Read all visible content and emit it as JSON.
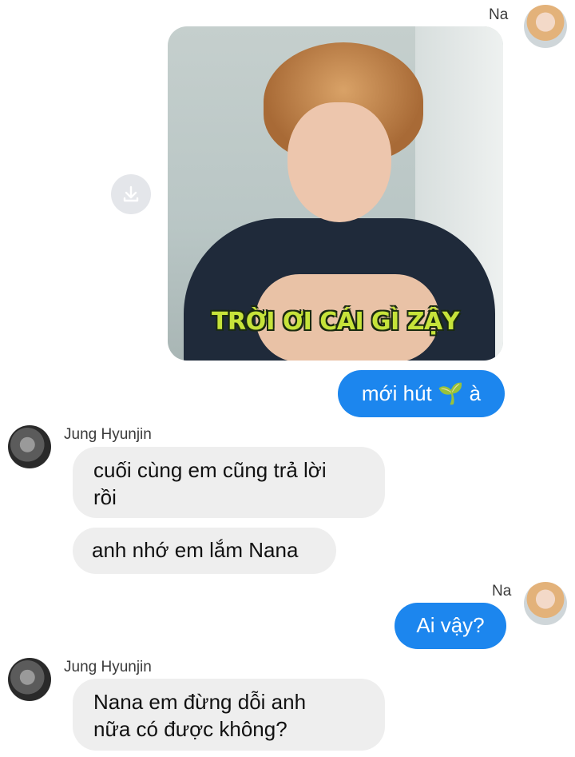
{
  "messages": {
    "m1": {
      "sender": "Na",
      "image_caption": "TRỜI ƠI CÁI GÌ ZẬY"
    },
    "m2": {
      "text": "mới hút 🌱 à"
    },
    "m3": {
      "sender": "Jung Hyunjin",
      "line1": "cuối cùng em cũng trả lời",
      "line2": "rồi"
    },
    "m4": {
      "text": "anh nhớ em lắm Nana"
    },
    "m5": {
      "sender": "Na",
      "text": "Ai vậy?"
    },
    "m6": {
      "sender": "Jung Hyunjin",
      "line1": "Nana em đừng dỗi anh",
      "line2": "nữa có được không?"
    }
  },
  "icons": {
    "download": "download-icon",
    "avatar_me": "avatar-na",
    "avatar_other": "avatar-jung-hyunjin"
  },
  "colors": {
    "outgoing_bubble": "#1c86ee",
    "incoming_bubble": "#eeeeee",
    "caption_text": "#c6e33a"
  }
}
